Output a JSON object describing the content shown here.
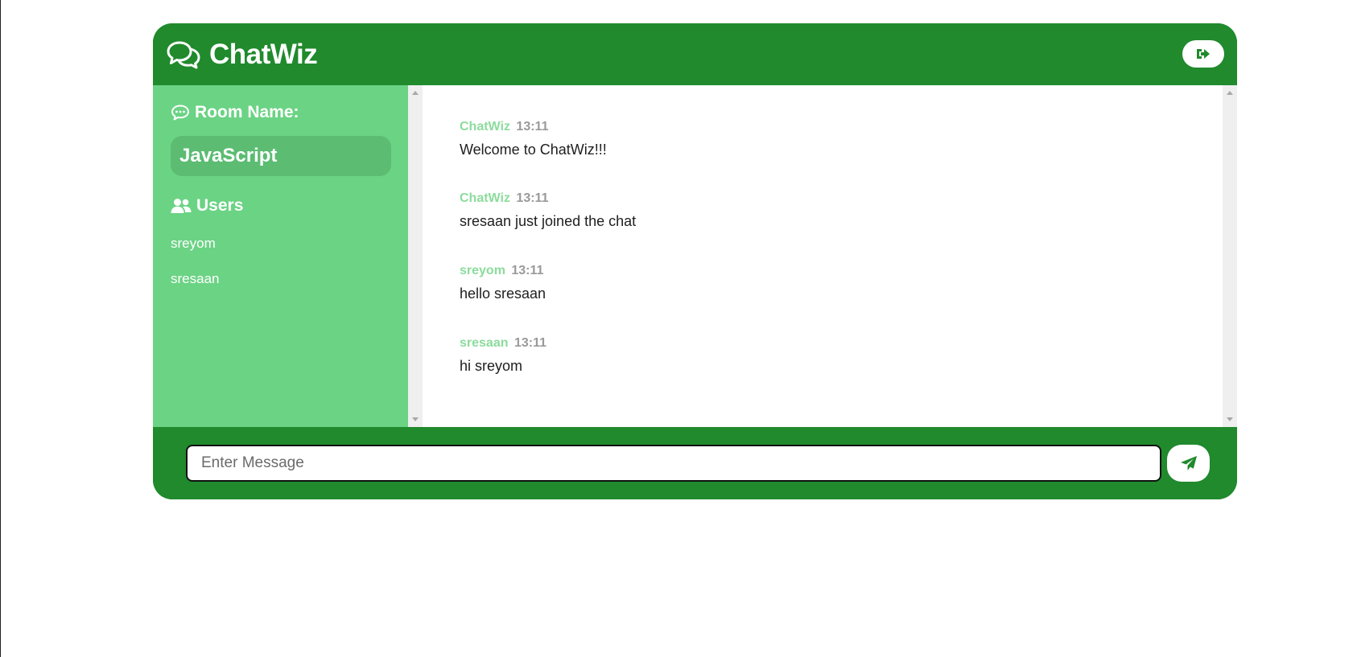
{
  "app": {
    "title": "ChatWiz",
    "brand_icon": "comments-icon",
    "leave_icon": "sign-out-icon",
    "colors": {
      "primary": "#208a2d",
      "sidebar": "#6bd384",
      "room_pill": "#5bbc72",
      "username": "#8cdc9d",
      "timestamp": "#9a9a9a"
    }
  },
  "sidebar": {
    "room_heading": "Room Name:",
    "room_heading_icon": "comment-dots-icon",
    "room_name": "JavaScript",
    "users_heading": "Users",
    "users_heading_icon": "users-icon",
    "users": [
      "sreyom",
      "sresaan"
    ]
  },
  "messages": [
    {
      "user": "ChatWiz",
      "time": "13:11",
      "text": "Welcome to ChatWiz!!!"
    },
    {
      "user": "ChatWiz",
      "time": "13:11",
      "text": "sresaan just joined the chat"
    },
    {
      "user": "sreyom",
      "time": "13:11",
      "text": "hello sresaan"
    },
    {
      "user": "sresaan",
      "time": "13:11",
      "text": "hi sreyom"
    }
  ],
  "composer": {
    "placeholder": "Enter Message",
    "value": "",
    "send_icon": "paper-plane-icon"
  }
}
